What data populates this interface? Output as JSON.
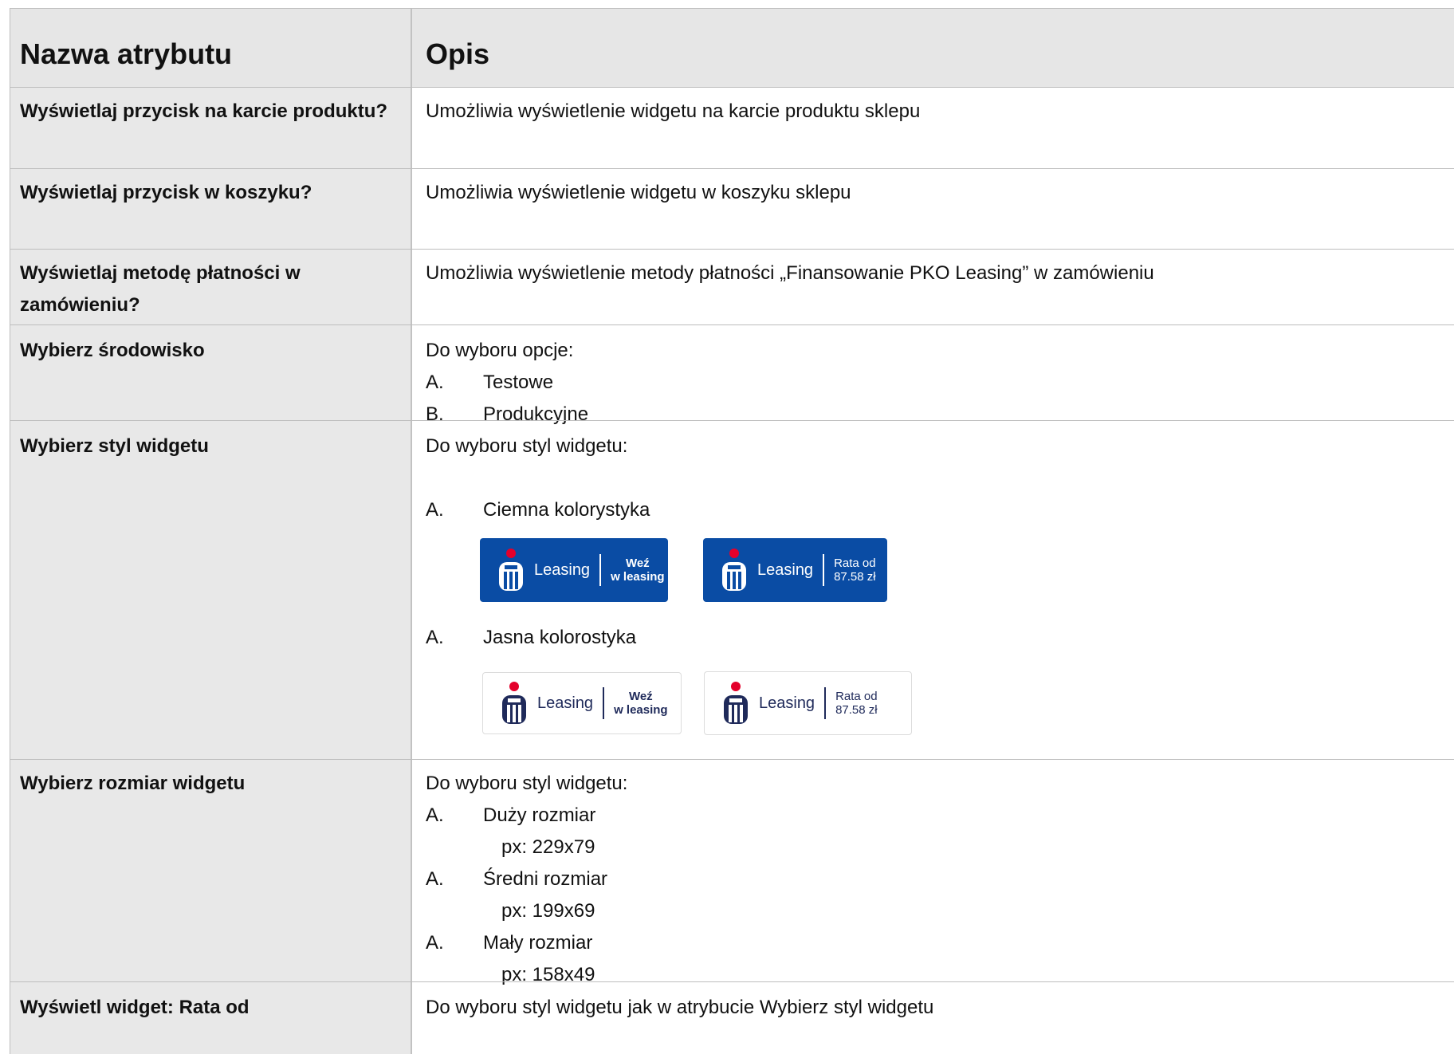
{
  "header": {
    "col1": "Nazwa atrybutu",
    "col2": "Opis"
  },
  "rows": {
    "r1": {
      "name": "Wyświetlaj przycisk na karcie produktu?",
      "desc": "Umożliwia wyświetlenie widgetu na karcie produktu sklepu"
    },
    "r2": {
      "name": "Wyświetlaj przycisk w koszyku?",
      "desc": "Umożliwia wyświetlenie widgetu w koszyku sklepu"
    },
    "r3": {
      "name_line1": "Wyświetlaj metodę płatności w",
      "name_line2": "zamówieniu?",
      "desc": "Umożliwia wyświetlenie metody płatności „Finansowanie PKO Leasing” w zamówieniu"
    },
    "r4": {
      "name": "Wybierz środowisko",
      "intro": "Do wyboru opcje:",
      "items": [
        {
          "marker": "A.",
          "text": "Testowe"
        },
        {
          "marker": "B.",
          "text": "Produkcyjne"
        }
      ]
    },
    "r5": {
      "name": "Wybierz styl widgetu",
      "intro": "Do wyboru styl widgetu:",
      "items": [
        {
          "marker": "A.",
          "text": "Ciemna kolorystyka"
        },
        {
          "marker": "A.",
          "text": "Jasna kolorostyka"
        }
      ]
    },
    "r6": {
      "name": "Wybierz rozmiar widgetu",
      "intro": "Do wyboru styl widgetu:",
      "items": [
        {
          "marker": "A.",
          "text": "Duży rozmiar",
          "px": "px: 229x79"
        },
        {
          "marker": "A.",
          "text": "Średni rozmiar",
          "px": "px: 199x69"
        },
        {
          "marker": "A.",
          "text": "Mały rozmiar",
          "px": "px: 158x49"
        }
      ]
    },
    "r7": {
      "name": "Wyświetl widget: Rata od",
      "desc": "Do wyboru styl widgetu jak w atrybucie Wybierz styl widgetu"
    }
  },
  "widgets": {
    "brand": "Leasing",
    "take_line1": "Weź",
    "take_line2": "w leasing",
    "rate_line1": "Rata od",
    "rate_line2": "87.58 zł"
  },
  "colors": {
    "pko_blue": "#0a4ca4",
    "pko_navy": "#1f2a5a",
    "pko_red": "#e4002b"
  }
}
